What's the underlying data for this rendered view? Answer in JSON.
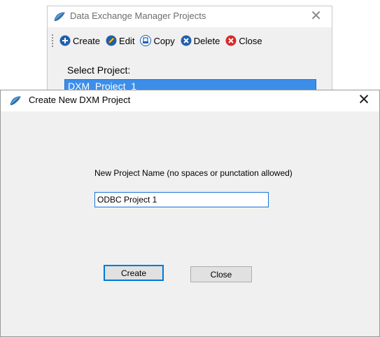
{
  "background_window": {
    "title": "Data Exchange Manager Projects",
    "close_glyph": "✕",
    "toolbar": [
      {
        "label": "Create",
        "icon": "plus-circle-icon",
        "color": "#1565c0"
      },
      {
        "label": "Edit",
        "icon": "pencil-icon",
        "color": "#1565c0"
      },
      {
        "label": "Copy",
        "icon": "copy-icon",
        "color": "#1565c0"
      },
      {
        "label": "Delete",
        "icon": "minus-circle-icon",
        "color": "#1565c0"
      },
      {
        "label": "Close",
        "icon": "close-circle-icon",
        "color": "#d32f2f"
      }
    ],
    "select_label": "Select Project:",
    "selected_project": "DXM_Project_1",
    "selection_color": "#3d8ee8"
  },
  "dialog": {
    "title": "Create New DXM Project",
    "close_glyph": "✕",
    "name_label": "New Project Name (no spaces or punctation allowed)",
    "name_value": "ODBC Project 1",
    "create_label": "Create",
    "close_label": "Close",
    "focus_color": "#0078d7"
  }
}
